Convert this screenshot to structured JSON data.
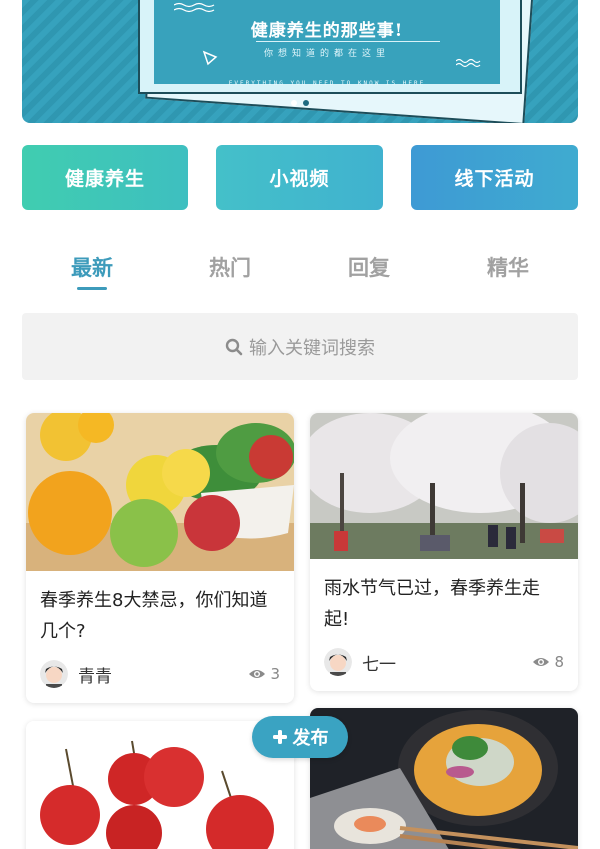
{
  "banner": {
    "title": "健康养生的那些事!",
    "subtitle": "你想知道的都在这里",
    "caption": "EVERYTHING YOU NEED TO KNOW IS HERE",
    "page_count": 2,
    "active_page": 1
  },
  "categories": [
    {
      "label": "健康养生",
      "color": "#3cc5b6"
    },
    {
      "label": "小视频",
      "color": "#42b9cb"
    },
    {
      "label": "线下活动",
      "color": "#3d9fd0"
    }
  ],
  "tabs": [
    {
      "label": "最新",
      "active": true
    },
    {
      "label": "热门",
      "active": false
    },
    {
      "label": "回复",
      "active": false
    },
    {
      "label": "精华",
      "active": false
    }
  ],
  "search": {
    "placeholder": "输入关键词搜索",
    "icon": "search-icon"
  },
  "posts": [
    {
      "title": "春季养生8大禁忌，你们知道几个?",
      "author": "青青",
      "views": "3",
      "image": "fruit-basket-image"
    },
    {
      "title": "雨水节气已过，春季养生走起!",
      "author": "七一",
      "views": "8",
      "image": "cherry-blossom-park-image"
    },
    {
      "title": "",
      "author": "",
      "views": "",
      "image": "red-crabapples-image"
    },
    {
      "title": "",
      "author": "",
      "views": "",
      "image": "noodle-soup-image"
    }
  ],
  "post_button": {
    "label": "发布",
    "icon": "plus-icon"
  },
  "colors": {
    "accent": "#3d9bbb",
    "inactive_tab": "#a1a1a1",
    "search_bg": "#f2f2f2"
  }
}
